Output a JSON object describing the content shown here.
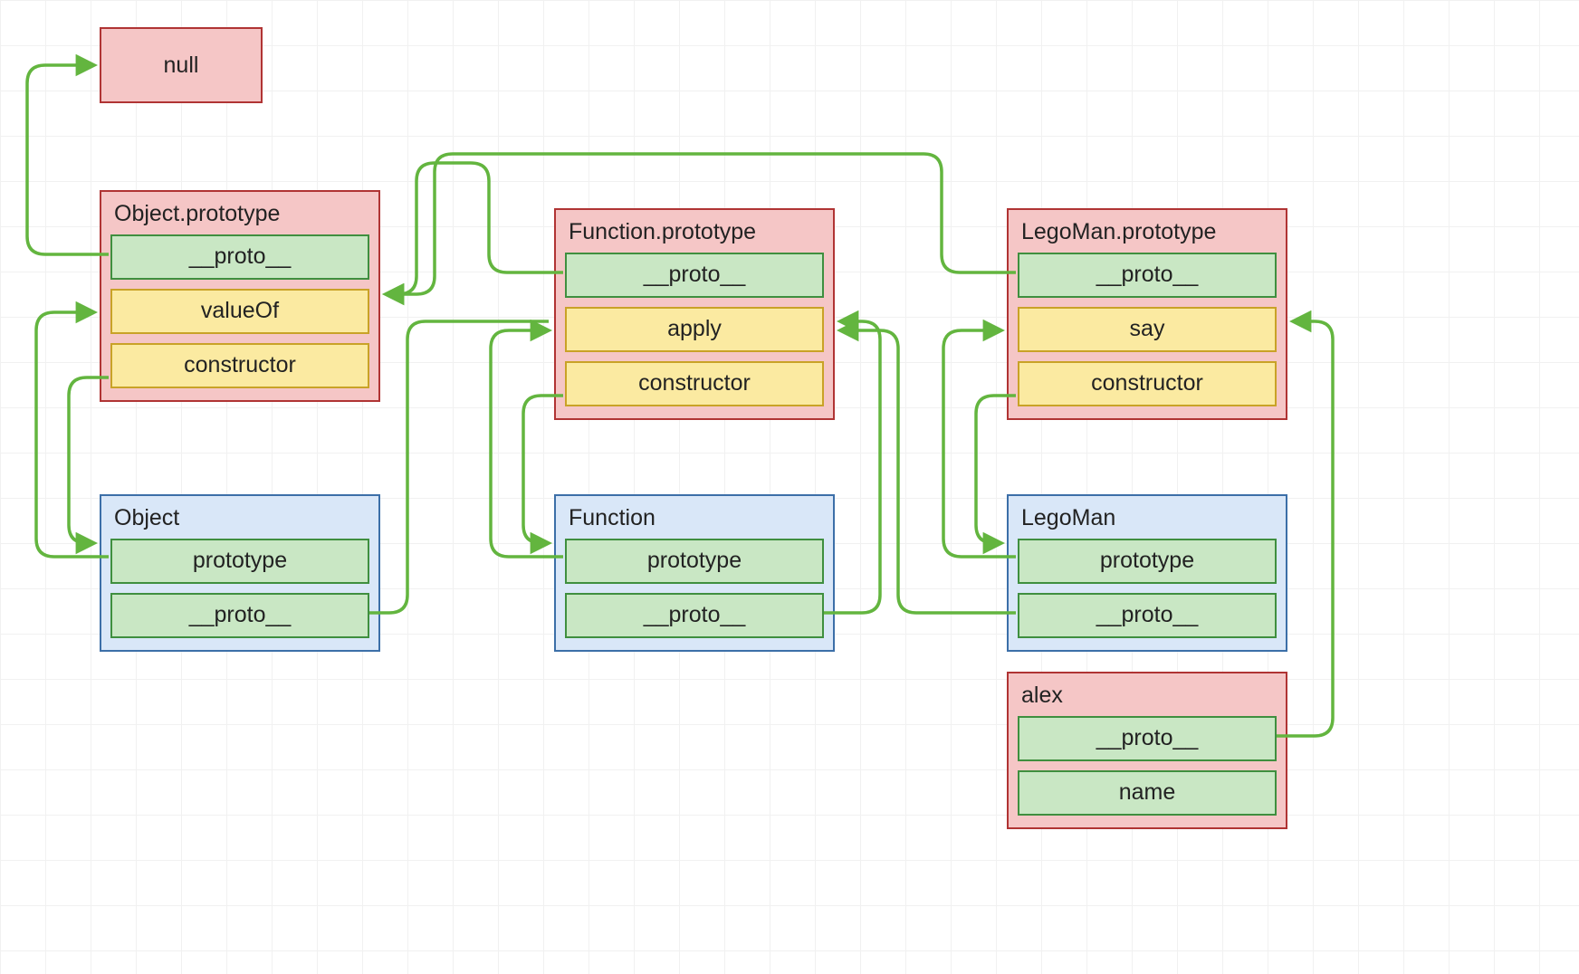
{
  "null_label": "null",
  "object_prototype": {
    "title": "Object.prototype",
    "proto": "__proto__",
    "valueOf": "valueOf",
    "constructor": "constructor"
  },
  "function_prototype": {
    "title": "Function.prototype",
    "proto": "__proto__",
    "apply": "apply",
    "constructor": "constructor"
  },
  "legoman_prototype": {
    "title": "LegoMan.prototype",
    "proto": "__proto__",
    "say": "say",
    "constructor": "constructor"
  },
  "object_ctor": {
    "title": "Object",
    "prototype": "prototype",
    "proto": "__proto__"
  },
  "function_ctor": {
    "title": "Function",
    "prototype": "prototype",
    "proto": "__proto__"
  },
  "legoman_ctor": {
    "title": "LegoMan",
    "prototype": "prototype",
    "proto": "__proto__"
  },
  "alex": {
    "title": "alex",
    "proto": "__proto__",
    "name": "name"
  },
  "arrows_desc": {
    "a1": "Object.prototype.__proto__ -> null",
    "a2": "Function.prototype.__proto__ -> Object.prototype",
    "a3": "LegoMan.prototype.__proto__ -> Object.prototype",
    "a4": "Object.prototype.constructor -> Object",
    "a5": "Function.prototype.constructor -> Function",
    "a6": "LegoMan.prototype.constructor -> LegoMan",
    "a7": "Object.prototype -> Function.prototype.apply",
    "a8": "Function.prototype -> LegoMan.prototype.say",
    "a9": "Object.__proto__ -> Function.prototype",
    "a10": "Function.__proto__ -> Function.prototype",
    "a11": "LegoMan.__proto__ -> Function.prototype",
    "a12": "alex.__proto__ -> LegoMan.prototype"
  }
}
